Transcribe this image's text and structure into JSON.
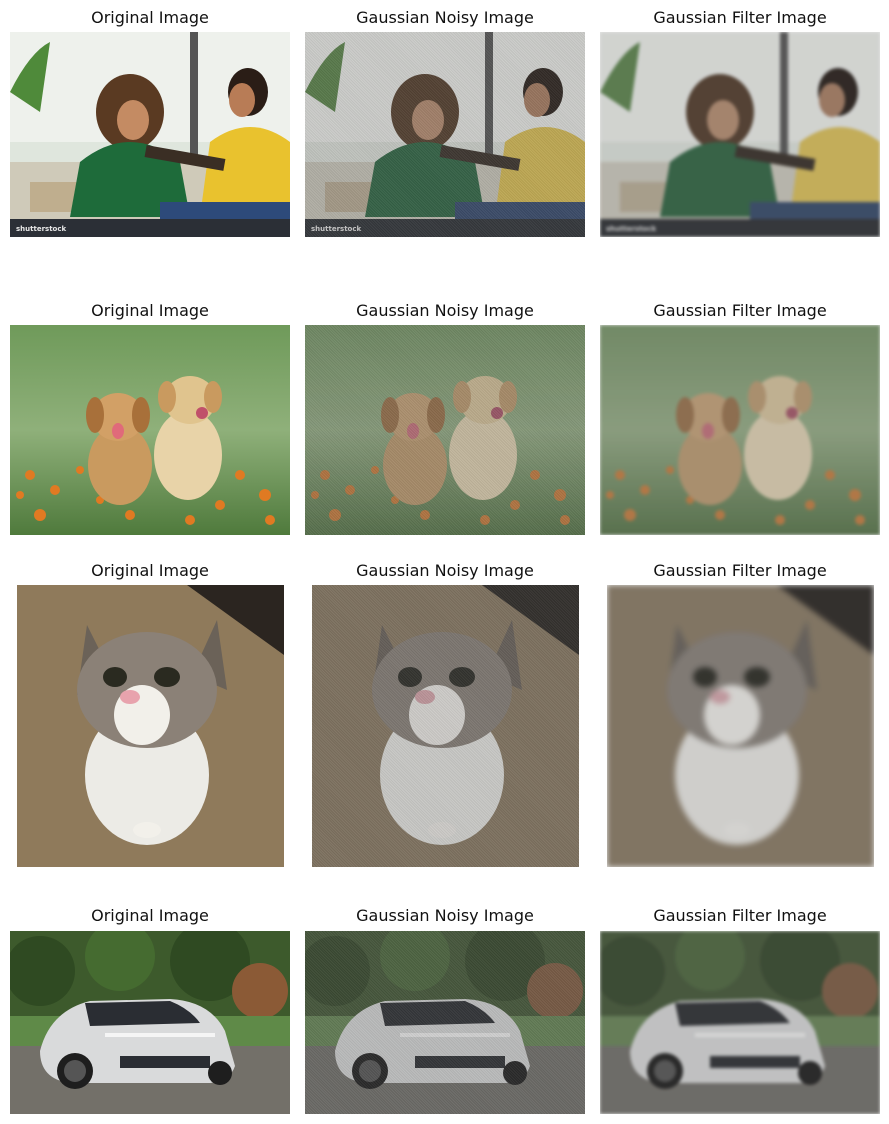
{
  "titles": {
    "original": "Original Image",
    "noisy": "Gaussian Noisy Image",
    "filtered": "Gaussian Filter Image"
  },
  "rows": [
    {
      "subject": "people-with-tablet",
      "watermark": "shutterstock"
    },
    {
      "subject": "two-puppies"
    },
    {
      "subject": "cat-on-carpet"
    },
    {
      "subject": "white-sedan"
    }
  ],
  "colors": {
    "sweater_green": "#1e6b3a",
    "sweater_yellow": "#e9c22e",
    "grass": "#5f8a48",
    "flowers": "#e07a22",
    "carpet": "#8f7a5b",
    "car": "#d9dadb"
  }
}
